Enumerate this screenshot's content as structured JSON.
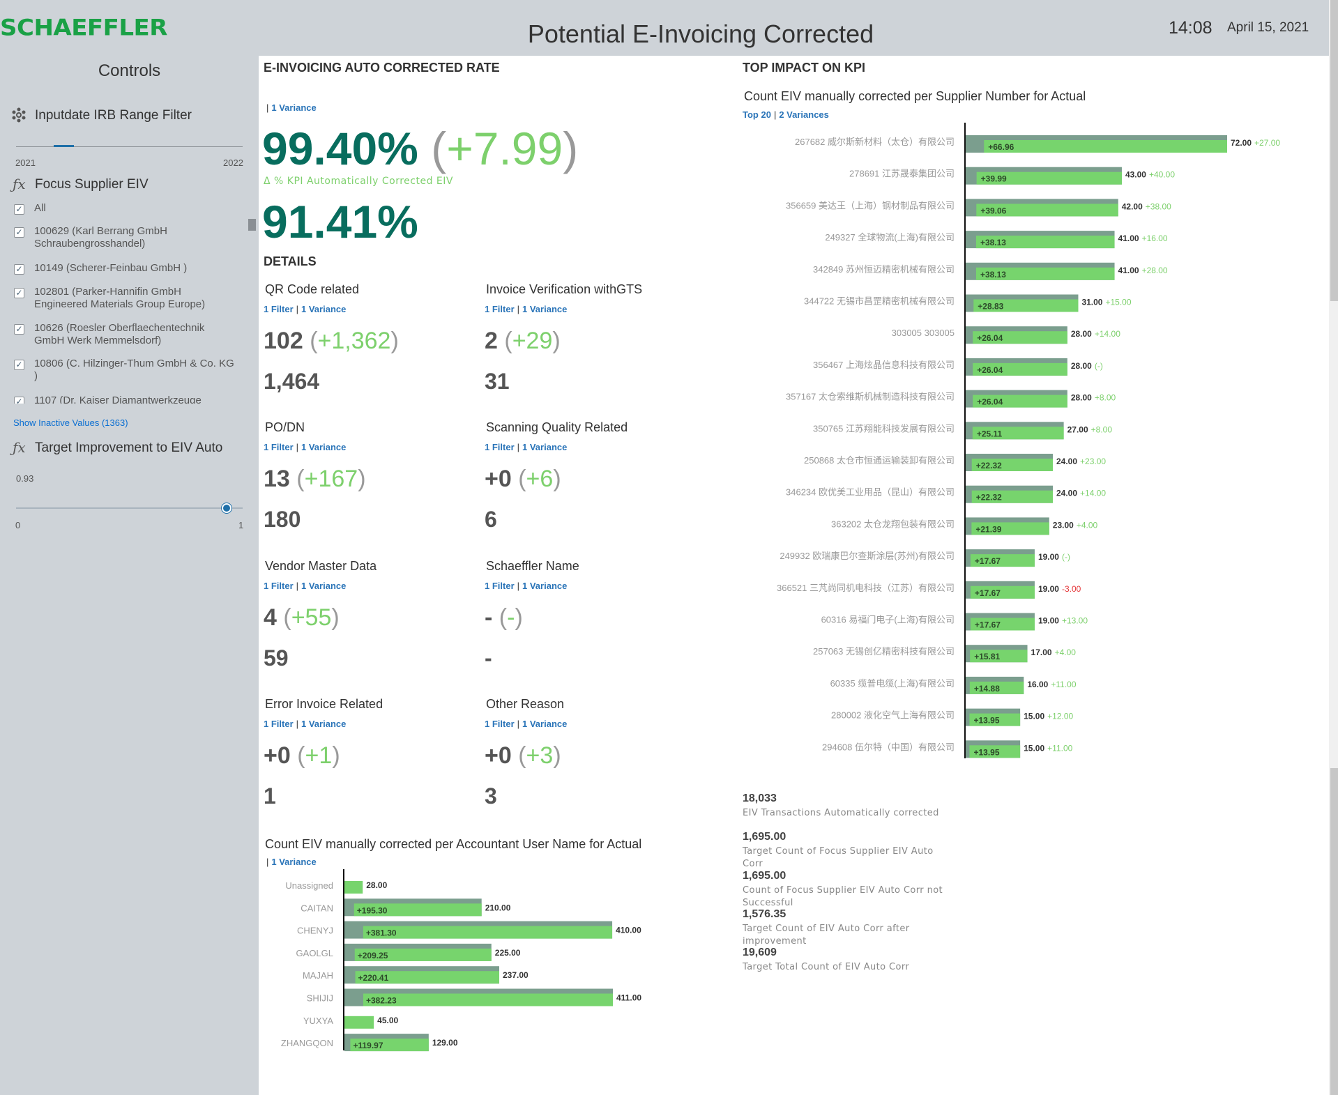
{
  "header": {
    "logo": "SCHAEFFLER",
    "title": "Potential E-Invoicing Corrected",
    "time": "14:08",
    "date": "April 15, 2021"
  },
  "controls": {
    "title": "Controls",
    "range_filter": {
      "label": "Inputdate IRB Range Filter",
      "min_label": "2021",
      "max_label": "2022"
    },
    "supplier_filter": {
      "label": "Focus Supplier EIV",
      "items": [
        {
          "label": "All",
          "checked": true
        },
        {
          "label": "100629 (Karl Berrang GmbH Schraubengrosshandel)",
          "checked": true
        },
        {
          "label": "10149 (Scherer-Feinbau GmbH )",
          "checked": true
        },
        {
          "label": "102801 (Parker-Hannifin GmbH Engineered Materials Group Europe)",
          "checked": true
        },
        {
          "label": "10626 (Roesler Oberflaechentechnik GmbH Werk Memmelsdorf)",
          "checked": true
        },
        {
          "label": "10806 (C. Hilzinger-Thum GmbH & Co. KG )",
          "checked": true
        },
        {
          "label": "1107 (Dr. Kaiser Diamantwerkzeuge",
          "checked": true
        }
      ],
      "show_inactive": "Show Inactive Values (1363)"
    },
    "target_filter": {
      "label": "Target Improvement to EIV Auto",
      "value_label": "0.93",
      "value": 0.93,
      "min_label": "0",
      "max_label": "1"
    }
  },
  "kpi": {
    "section_title": "E-INVOICING AUTO CORRECTED RATE",
    "link": "1 Variance",
    "value": "99.40%",
    "variance": "+7.99",
    "caption": "Δ % KPI Automatically Corrected EIV",
    "total": "91.41%"
  },
  "details": {
    "section_title": "DETAILS",
    "filter_link": "1 Filter",
    "variance_link": "1 Variance",
    "tiles": [
      {
        "title": "QR Code related",
        "value": "102",
        "variance": "+1,362",
        "total": "1,464"
      },
      {
        "title": "Invoice Verification withGTS",
        "value": "2",
        "variance": "+29",
        "total": "31"
      },
      {
        "title": "PO/DN",
        "value": "13",
        "variance": "+167",
        "total": "180"
      },
      {
        "title": "Scanning Quality Related",
        "value": "+0",
        "variance": "+6",
        "total": "6"
      },
      {
        "title": "Vendor Master  Data",
        "value": "4",
        "variance": "+55",
        "total": "59"
      },
      {
        "title": "Schaeffler Name",
        "value": "-",
        "variance": "-",
        "total": "-"
      },
      {
        "title": "Error Invoice Related",
        "value": "+0",
        "variance": "+1",
        "total": "1"
      },
      {
        "title": "Other Reason",
        "value": "+0",
        "variance": "+3",
        "total": "3"
      }
    ]
  },
  "top_impact": {
    "section_title": "TOP IMPACT ON KPI",
    "chart_title": "Count EIV manually corrected per Supplier Number for Actual",
    "link_top": "Top 20",
    "link_variances": "2 Variances"
  },
  "stats": [
    {
      "value": "18,033",
      "label": "EIV Transactions Automatically corrected"
    },
    {
      "value": "1,695.00",
      "label": "Target Count of Focus Supplier EIV Auto Corr"
    },
    {
      "value": "1,695.00",
      "label": "Count of Focus Supplier EIV Auto Corr not Successful"
    },
    {
      "value": "1,576.35",
      "label": "Target Count of EIV Auto Corr after improvement"
    },
    {
      "value": "19,609",
      "label": "Target Total Count of EIV Auto Corr"
    }
  ],
  "accountant_chart_meta": {
    "title": "Count EIV manually corrected per Accountant User Name for Actual",
    "link": "1 Variance"
  },
  "colors": {
    "kpi_green": "#086d5e",
    "variance_green": "#7dd06c",
    "bar_green": "#77d46d",
    "bar_ref": "#7b9e8e",
    "negative": "#e5383b",
    "link_blue": "#2a74b8"
  },
  "chart_data": [
    {
      "type": "bar",
      "orientation": "horizontal",
      "title": "Count EIV manually corrected per Supplier Number for Actual",
      "categories": [
        "267682 威尔斯新材料（太仓）有限公司",
        "278691 江苏晟泰集团公司",
        "356659 美达王（上海）钢材制品有限公司",
        "249327 全球物流(上海)有限公司",
        "342849 苏州恒迈精密机械有限公司",
        "344722 无锡市昌罡精密机械有限公司",
        "303005 303005",
        "356467 上海炫晶信息科技有限公司",
        "357167 太仓索维斯机械制造科技有限公司",
        "350765 江苏翔能科技发展有限公司",
        "250868 太仓市恒通运输装卸有限公司",
        "346234 欧优美工业用品（昆山）有限公司",
        "363202 太仓龙翔包装有限公司",
        "249932 欧瑞康巴尔查斯涂层(苏州)有限公司",
        "366521 三芃尚同机电科技（江苏）有限公司",
        "60316 易福门电子(上海)有限公司",
        "257063 无锡创亿精密科技有限公司",
        "60335 缆普电缆(上海)有限公司",
        "280002 液化空气上海有限公司",
        "294608 伍尔特（中国）有限公司"
      ],
      "values": [
        72.0,
        43.0,
        42.0,
        41.0,
        41.0,
        31.0,
        28.0,
        28.0,
        28.0,
        27.0,
        24.0,
        24.0,
        23.0,
        19.0,
        19.0,
        19.0,
        17.0,
        16.0,
        15.0,
        15.0
      ],
      "value_labels": [
        "72.00",
        "43.00",
        "42.00",
        "41.00",
        "41.00",
        "31.00",
        "28.00",
        "28.00",
        "28.00",
        "27.00",
        "24.00",
        "24.00",
        "23.00",
        "19.00",
        "19.00",
        "19.00",
        "17.00",
        "16.00",
        "15.00",
        "15.00"
      ],
      "variance_labels": [
        "+66.96",
        "+39.99",
        "+39.06",
        "+38.13",
        "+38.13",
        "+28.83",
        "+26.04",
        "+26.04",
        "+26.04",
        "+25.11",
        "+22.32",
        "+22.32",
        "+21.39",
        "+17.67",
        "+17.67",
        "+17.67",
        "+15.81",
        "+14.88",
        "+13.95",
        "+13.95"
      ],
      "change_labels": [
        "+27.00",
        "+40.00",
        "+38.00",
        "+16.00",
        "+28.00",
        "+15.00",
        "+14.00",
        "(-)",
        "+8.00",
        "+8.00",
        "+23.00",
        "+14.00",
        "+4.00",
        "(-)",
        "-3.00",
        "+13.00",
        "+4.00",
        "+11.00",
        "+12.00",
        "+11.00"
      ],
      "change_negative": [
        false,
        false,
        false,
        false,
        false,
        false,
        false,
        false,
        false,
        false,
        false,
        false,
        false,
        false,
        true,
        false,
        false,
        false,
        false,
        false
      ]
    },
    {
      "type": "bar",
      "orientation": "horizontal",
      "title": "Count EIV manually corrected per Accountant User Name for Actual",
      "categories": [
        "Unassigned",
        "CAITAN",
        "CHENYJ",
        "GAOLGL",
        "MAJAH",
        "SHIJIJ",
        "YUXYA",
        "ZHANGQON"
      ],
      "values": [
        28.0,
        210.0,
        410.0,
        225.0,
        237.0,
        411.0,
        45.0,
        129.0
      ],
      "value_labels": [
        "28.00",
        "210.00",
        "410.00",
        "225.00",
        "237.00",
        "411.00",
        "45.00",
        "129.00"
      ],
      "variance_labels": [
        "",
        "+195.30",
        "+381.30",
        "+209.25",
        "+220.41",
        "+382.23",
        "",
        "+119.97"
      ]
    }
  ]
}
